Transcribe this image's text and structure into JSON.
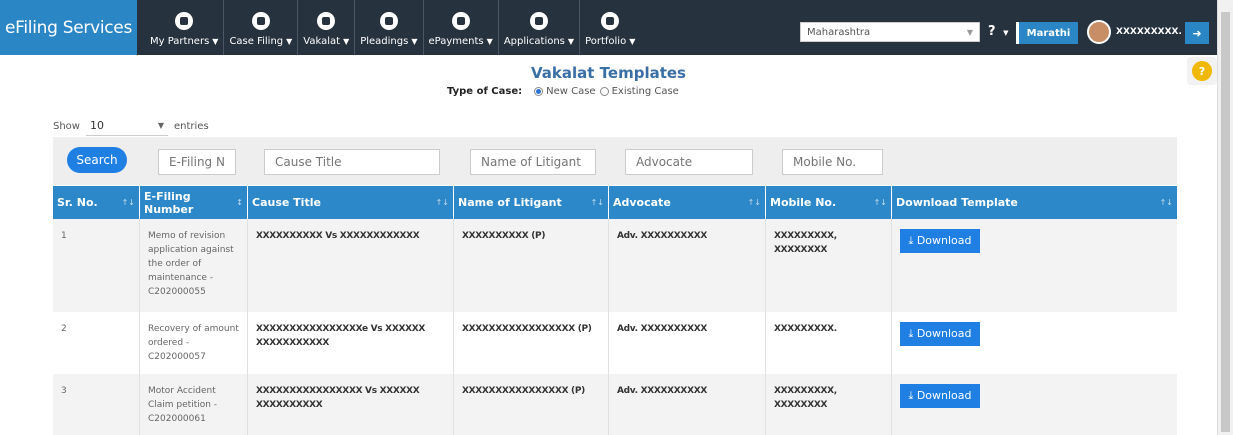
{
  "brand": "eFiling Services",
  "nav": [
    {
      "label": "My Partners",
      "icon": "handshake-icon"
    },
    {
      "label": "Case Filing",
      "icon": "pencil-icon"
    },
    {
      "label": "Vakalat",
      "icon": "document-icon"
    },
    {
      "label": "Pleadings",
      "icon": "scales-icon"
    },
    {
      "label": "ePayments",
      "icon": "rupee-icon"
    },
    {
      "label": "Applications",
      "icon": "file-icon"
    },
    {
      "label": "Portfolio",
      "icon": "briefcase-icon"
    }
  ],
  "header": {
    "state": "Maharashtra",
    "help": "?",
    "language": "Marathi",
    "user": "XXXXXXXXX."
  },
  "page": {
    "title": "Vakalat Templates",
    "type_label": "Type of Case:",
    "option_new": "New Case",
    "option_existing": "Existing Case",
    "show": "Show",
    "entries_value": "10",
    "entries": "entries"
  },
  "filters": {
    "search": "Search",
    "efiling": "E-Filing Num",
    "cause": "Cause Title",
    "litigant": "Name of Litigant",
    "advocate": "Advocate",
    "mobile": "Mobile No."
  },
  "columns": [
    "Sr. No.",
    "E-Filing Number",
    "Cause Title",
    "Name of Litigant",
    "Advocate",
    "Mobile No.",
    "Download Template"
  ],
  "rows": [
    {
      "sr": "1",
      "efiling": "Memo of revision application against the order of maintenance - C202000055",
      "cause": "XXXXXXXXXX Vs XXXXXXXXXXXX",
      "litigant": "XXXXXXXXXX (P)",
      "advocate": "Adv. XXXXXXXXXX",
      "mobile": "XXXXXXXXX, XXXXXXXX",
      "download": "Download"
    },
    {
      "sr": "2",
      "efiling": "Recovery of amount ordered - C202000057",
      "cause": "XXXXXXXXXXXXXXXXe Vs XXXXXX XXXXXXXXXXX",
      "litigant": "XXXXXXXXXXXXXXXXX (P)",
      "advocate": "Adv. XXXXXXXXXX",
      "mobile": "XXXXXXXXX.",
      "download": "Download"
    },
    {
      "sr": "3",
      "efiling": "Motor Accident Claim petition - C202000061",
      "cause": "XXXXXXXXXXXXXXXX Vs XXXXXX XXXXXXXXXX",
      "litigant": "XXXXXXXXXXXXXXXX (P)",
      "advocate": "Adv. XXXXXXXXXX",
      "mobile": "XXXXXXXXX, XXXXXXXX",
      "download": "Download"
    }
  ]
}
